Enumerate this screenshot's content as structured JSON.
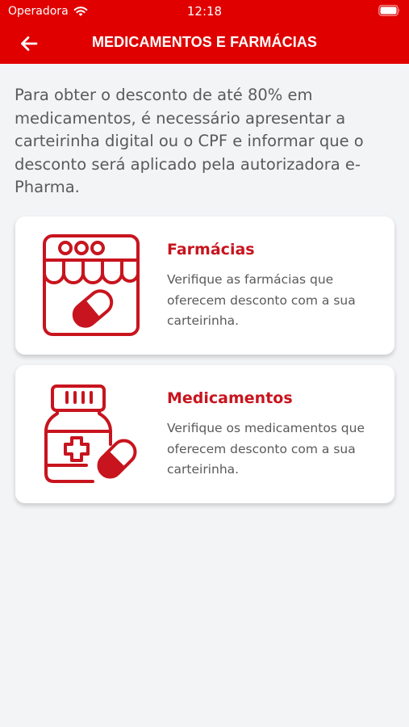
{
  "status_bar": {
    "carrier": "Operadora",
    "time": "12:18"
  },
  "nav": {
    "title": "MEDICAMENTOS E FARMÁCIAS"
  },
  "intro_text": "Para obter o desconto de até 80% em medicamentos, é necessário apresentar a carteirinha digital ou o CPF e informar que o desconto será aplicado pela autorizadora e-Pharma.",
  "cards": [
    {
      "title": "Farmácias",
      "description": "Verifique as farmácias que oferecem desconto com a sua carteirinha.",
      "icon": "pharmacy-store-icon"
    },
    {
      "title": "Medicamentos",
      "description": "Verifique os medicamentos que oferecem desconto com a sua carteirinha.",
      "icon": "medicine-bottle-icon"
    }
  ],
  "colors": {
    "brand_red": "#e00000",
    "icon_red": "#c8141e",
    "text_gray": "#5a5a5a",
    "background": "#f3f4f6"
  }
}
